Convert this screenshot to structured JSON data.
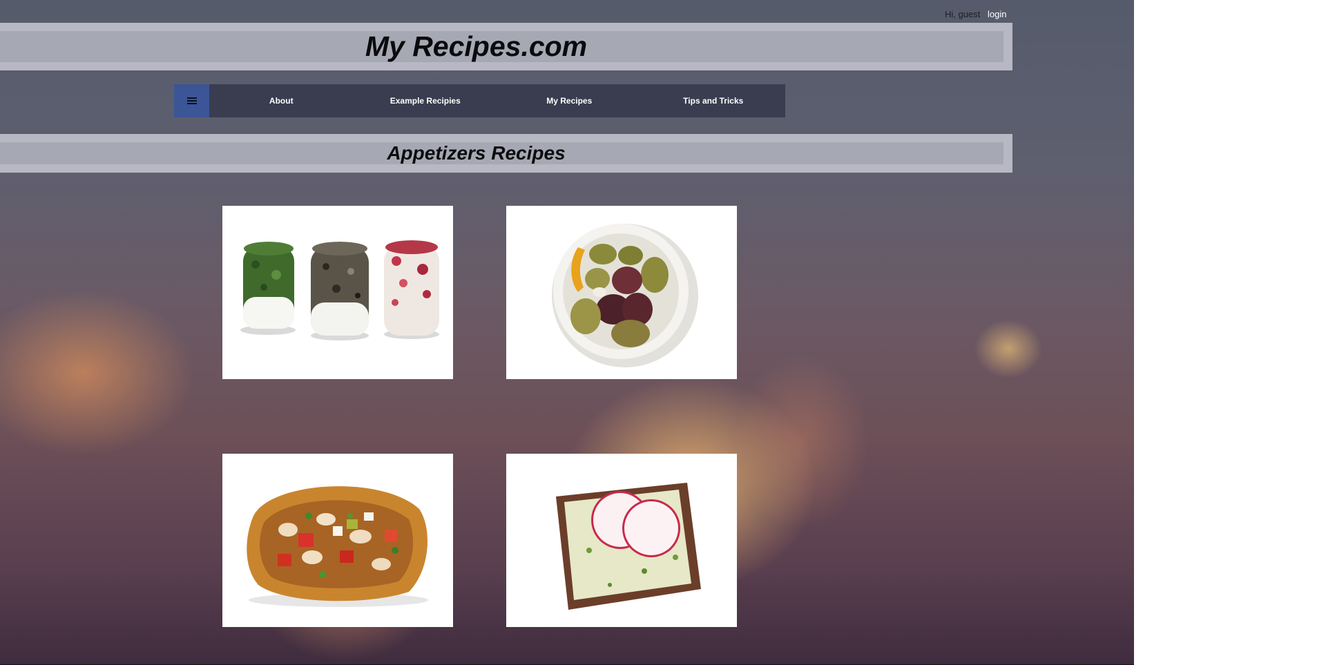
{
  "user": {
    "greeting": "Hi, guest",
    "login_label": "login"
  },
  "site": {
    "title": "My Recipes.com"
  },
  "nav": {
    "menu_icon": "hamburger-menu-icon",
    "items": [
      {
        "label": "About"
      },
      {
        "label": "Example Recipies"
      },
      {
        "label": "My Recipes"
      },
      {
        "label": "Tips and Tricks"
      }
    ]
  },
  "section": {
    "title": "Appetizers Recipes"
  },
  "recipes": [
    {
      "image": "goat-cheese-logs"
    },
    {
      "image": "marinated-olives-bowl"
    },
    {
      "image": "bean-salad-crostini"
    },
    {
      "image": "radish-rye-toast"
    }
  ],
  "colors": {
    "nav_background": "#3a3c50",
    "menu_toggle": "#3b5597",
    "banner": "#c8c8d2",
    "login_link": "#ffffff"
  }
}
